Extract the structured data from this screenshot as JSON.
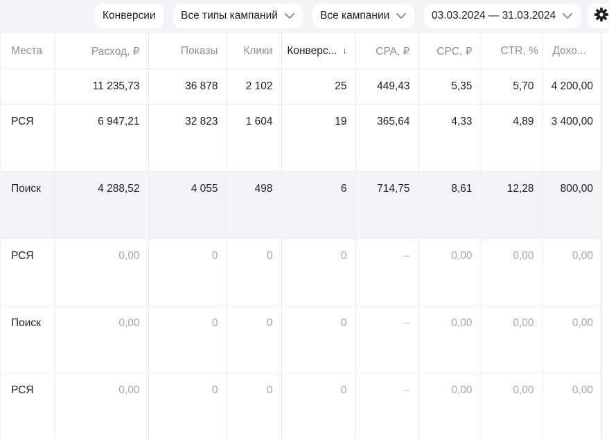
{
  "filters": {
    "metric": "Конверсии",
    "campaign_types": "Все типы кампаний",
    "campaigns": "Все кампании",
    "date_range": "03.03.2024 — 31.03.2024"
  },
  "table": {
    "columns": [
      "Места",
      "Расход, ₽",
      "Показы",
      "Клики",
      "Конверс...",
      "CPA, ₽",
      "CPC, ₽",
      "CTR, %",
      "Дохо..."
    ],
    "sort_arrow": "↓",
    "total": [
      "",
      "11 235,73",
      "36 878",
      "2 102",
      "25",
      "449,43",
      "5,35",
      "5,70",
      "4 200,00"
    ],
    "rows": [
      [
        "РСЯ",
        "6 947,21",
        "32 823",
        "1 604",
        "19",
        "365,64",
        "4,33",
        "4,89",
        "3 400,00"
      ],
      [
        "Поиск",
        "4 288,52",
        "4 055",
        "498",
        "6",
        "714,75",
        "8,61",
        "12,28",
        "800,00"
      ],
      [
        "РСЯ",
        "0,00",
        "0",
        "0",
        "0",
        "–",
        "0,00",
        "0,00",
        "0,00"
      ],
      [
        "Поиск",
        "0,00",
        "0",
        "0",
        "0",
        "–",
        "0,00",
        "0,00",
        "0,00"
      ],
      [
        "РСЯ",
        "0,00",
        "0",
        "0",
        "0",
        "–",
        "0,00",
        "0,00",
        "0,00"
      ]
    ]
  },
  "colors": {
    "background": "#f2f4f7",
    "highlight_row": "#f2f4f8",
    "muted_text": "#a3a9b1"
  }
}
